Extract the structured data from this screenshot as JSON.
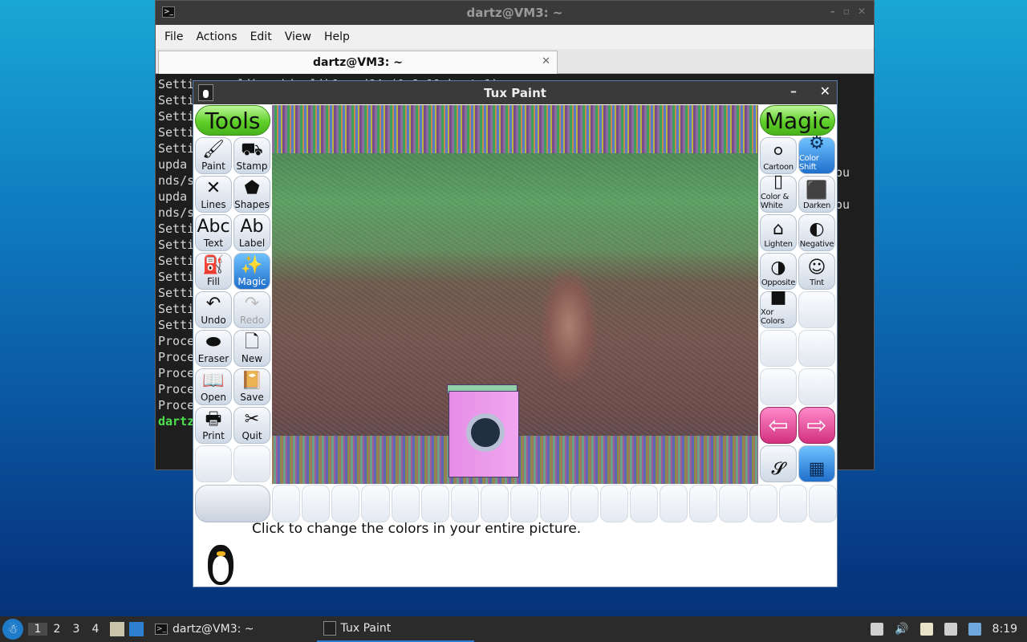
{
  "terminal": {
    "title": "dartz@VM3: ~",
    "menu": [
      "File",
      "Actions",
      "Edit",
      "View",
      "Help"
    ],
    "tab_label": "dartz@VM3: ~",
    "lines": [
      "Setting up libavahi-glib1:amd64 (0.8-11ubuntu1)",
      "Setti",
      "Setti",
      "Setti",
      "Setti",
      "upda",
      "nds/s",
      "upda",
      "nds/s",
      "Setti",
      "Setti",
      "Setti",
      "Setti",
      "Setti",
      "Setti",
      "Setti",
      "Proce",
      "Proce",
      "Proce",
      "Proce",
      "Proce"
    ],
    "prompt": "dartz",
    "right_fragments": [
      "ou",
      "ou"
    ]
  },
  "tuxpaint": {
    "title": "Tux Paint",
    "tools_header": "Tools",
    "magic_header": "Magic",
    "tools": [
      {
        "label": "Paint",
        "icon": "paintbrush-icon",
        "glyph": "🖌",
        "state": "normal"
      },
      {
        "label": "Stamp",
        "icon": "stamp-icon",
        "glyph": "⛟",
        "state": "normal"
      },
      {
        "label": "Lines",
        "icon": "lines-icon",
        "glyph": "✕",
        "state": "normal"
      },
      {
        "label": "Shapes",
        "icon": "shapes-icon",
        "glyph": "⬟",
        "state": "normal"
      },
      {
        "label": "Text",
        "icon": "text-icon",
        "glyph": "Abc",
        "state": "normal"
      },
      {
        "label": "Label",
        "icon": "label-icon",
        "glyph": "Ab",
        "state": "normal"
      },
      {
        "label": "Fill",
        "icon": "fill-bucket-icon",
        "glyph": "⛽",
        "state": "normal"
      },
      {
        "label": "Magic",
        "icon": "magic-wand-icon",
        "glyph": "✨",
        "state": "selected"
      },
      {
        "label": "Undo",
        "icon": "undo-icon",
        "glyph": "↶",
        "state": "normal"
      },
      {
        "label": "Redo",
        "icon": "redo-icon",
        "glyph": "↷",
        "state": "disabled"
      },
      {
        "label": "Eraser",
        "icon": "eraser-icon",
        "glyph": "⬬",
        "state": "normal"
      },
      {
        "label": "New",
        "icon": "new-document-icon",
        "glyph": "🗋",
        "state": "normal"
      },
      {
        "label": "Open",
        "icon": "open-book-icon",
        "glyph": "📖",
        "state": "normal"
      },
      {
        "label": "Save",
        "icon": "save-book-icon",
        "glyph": "📔",
        "state": "normal"
      },
      {
        "label": "Print",
        "icon": "printer-icon",
        "glyph": "🖶",
        "state": "normal"
      },
      {
        "label": "Quit",
        "icon": "quit-icon",
        "glyph": "✂",
        "state": "normal"
      }
    ],
    "magic_tools": [
      {
        "label": "Cartoon",
        "icon": "cartoon-icon",
        "glyph": "⚪",
        "state": "normal"
      },
      {
        "label": "Color Shift",
        "icon": "color-shift-icon",
        "glyph": "⚙",
        "state": "selected"
      },
      {
        "label": "Color & White",
        "icon": "color-white-icon",
        "glyph": "▯",
        "state": "normal"
      },
      {
        "label": "Darken",
        "icon": "darken-icon",
        "glyph": "⬛",
        "state": "normal"
      },
      {
        "label": "Lighten",
        "icon": "house-icon",
        "glyph": "⌂",
        "state": "normal"
      },
      {
        "label": "Negative",
        "icon": "negative-icon",
        "glyph": "◐",
        "state": "normal"
      },
      {
        "label": "Opposite",
        "icon": "opposite-icon",
        "glyph": "◑",
        "state": "normal"
      },
      {
        "label": "Tint",
        "icon": "tint-icon",
        "glyph": "☺",
        "state": "normal"
      },
      {
        "label": "Xor Colors",
        "icon": "xor-colors-icon",
        "glyph": "■",
        "state": "normal"
      }
    ],
    "tip": "Click to change the colors in your entire picture."
  },
  "taskbar": {
    "workspaces": [
      "1",
      "2",
      "3",
      "4"
    ],
    "tasks": [
      "dartz@VM3: ~",
      "Tux Paint"
    ],
    "clock": "8:19"
  }
}
